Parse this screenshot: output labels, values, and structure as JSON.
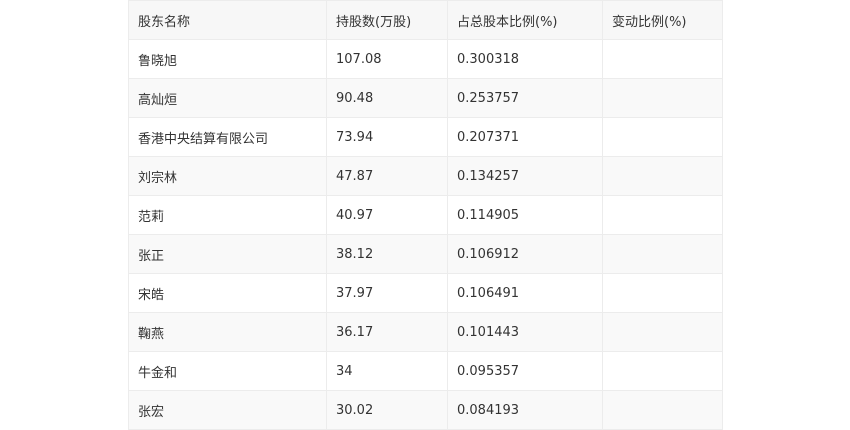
{
  "table": {
    "headers": [
      "股东名称",
      "持股数(万股)",
      "占总股本比例(%)",
      "变动比例(%)"
    ],
    "rows": [
      [
        "鲁晓旭",
        "107.08",
        "0.300318",
        ""
      ],
      [
        "高灿烜",
        "90.48",
        "0.253757",
        ""
      ],
      [
        "香港中央结算有限公司",
        "73.94",
        "0.207371",
        ""
      ],
      [
        "刘宗林",
        "47.87",
        "0.134257",
        ""
      ],
      [
        "范莉",
        "40.97",
        "0.114905",
        ""
      ],
      [
        "张正",
        "38.12",
        "0.106912",
        ""
      ],
      [
        "宋皓",
        "37.97",
        "0.106491",
        ""
      ],
      [
        "鞠燕",
        "36.17",
        "0.101443",
        ""
      ],
      [
        "牛金和",
        "34",
        "0.095357",
        ""
      ],
      [
        "张宏",
        "30.02",
        "0.084193",
        ""
      ]
    ]
  }
}
